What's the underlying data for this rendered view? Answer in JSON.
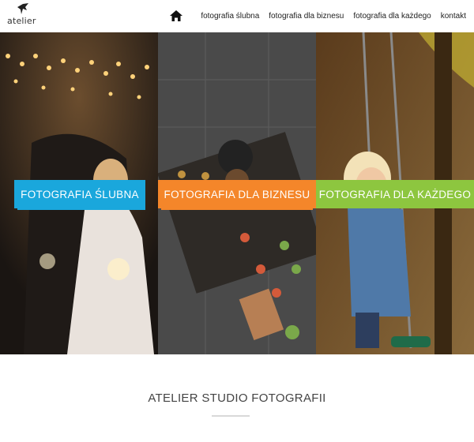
{
  "logo": {
    "text": "atelier"
  },
  "nav": {
    "items": [
      {
        "label": "fotografia ślubna"
      },
      {
        "label": "fotografia dla biznesu"
      },
      {
        "label": "fotografia dla każdego"
      },
      {
        "label": "kontakt"
      }
    ]
  },
  "panels": [
    {
      "label": "FOTOGRAFIA ŚLUBNA",
      "color": "#1aa7dc"
    },
    {
      "label": "FOTOGRAFIA DLA BIZNESU",
      "color": "#f4862a"
    },
    {
      "label": "FOTOGRAFIA DLA KAŻDEGO",
      "color": "#8dc63f"
    }
  ],
  "section": {
    "title": "ATELIER STUDIO FOTOGRAFII"
  }
}
